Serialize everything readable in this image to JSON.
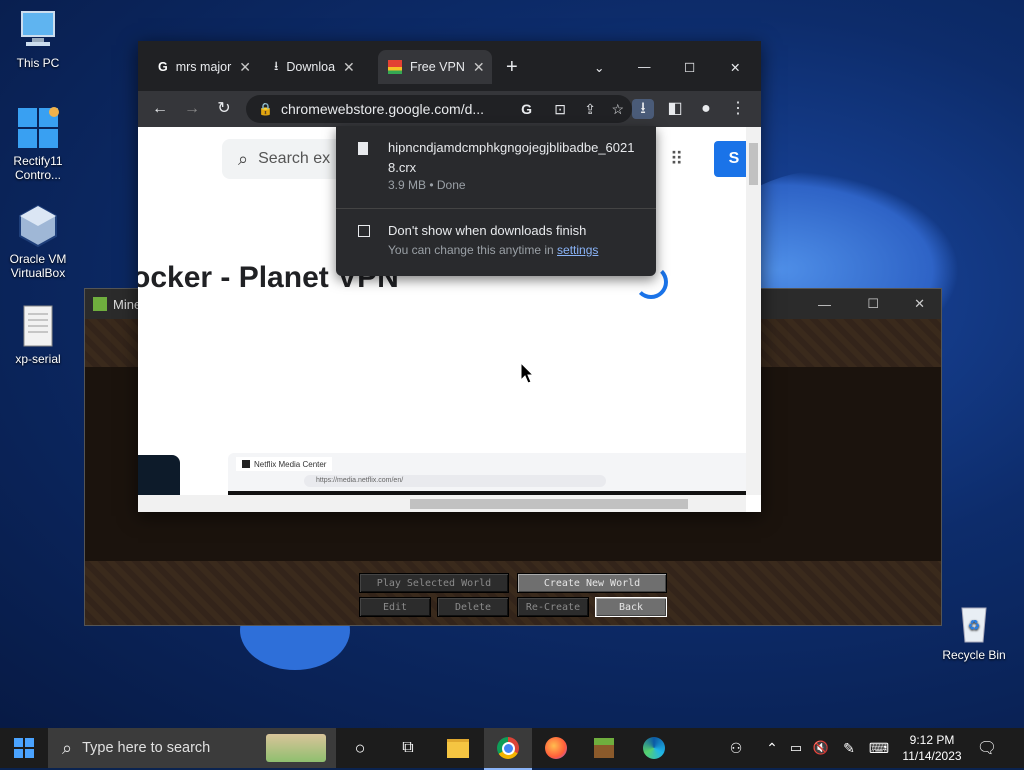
{
  "desktop": {
    "icons": [
      {
        "label": "This PC"
      },
      {
        "label": "Rectify11 Contro..."
      },
      {
        "label": "Oracle VM VirtualBox"
      },
      {
        "label": "xp-serial"
      },
      {
        "label": "Recycle Bin"
      }
    ]
  },
  "minecraft": {
    "title": "Mine",
    "buttons": {
      "play_selected": "Play Selected World",
      "create_new": "Create New World",
      "edit": "Edit",
      "delete": "Delete",
      "recreate": "Re-Create",
      "back": "Back"
    }
  },
  "chrome": {
    "tabs": [
      {
        "label": "mrs major",
        "icon": "google-icon"
      },
      {
        "label": "Downloa",
        "icon": "download-icon"
      },
      {
        "label": "Free VPN",
        "icon": "webstore-icon"
      }
    ],
    "omnibox_text": "chromewebstore.google.com/d...",
    "page": {
      "search_placeholder": "Search ex",
      "heading": "ocker - Planet VPN",
      "sign_in_fragment": "S",
      "preview_tab": "Netflix Media Center",
      "preview_url": "https://media.netflix.com/en/"
    },
    "download_popup": {
      "filename": "hipncndjamdcmphkgngojegjblibadbe_60218.crx",
      "status": "3.9 MB • Done",
      "checkbox_label": "Don't show when downloads finish",
      "hint_text": "You can change this anytime in",
      "hint_link": "settings"
    }
  },
  "taskbar": {
    "search_placeholder": "Type here to search",
    "time": "9:12 PM",
    "date": "11/14/2023"
  },
  "colors": {
    "chrome_dark": "#202124",
    "chrome_toolbar": "#35363a",
    "accent_blue": "#1a73e8",
    "taskbar": "#1c1c1c"
  }
}
